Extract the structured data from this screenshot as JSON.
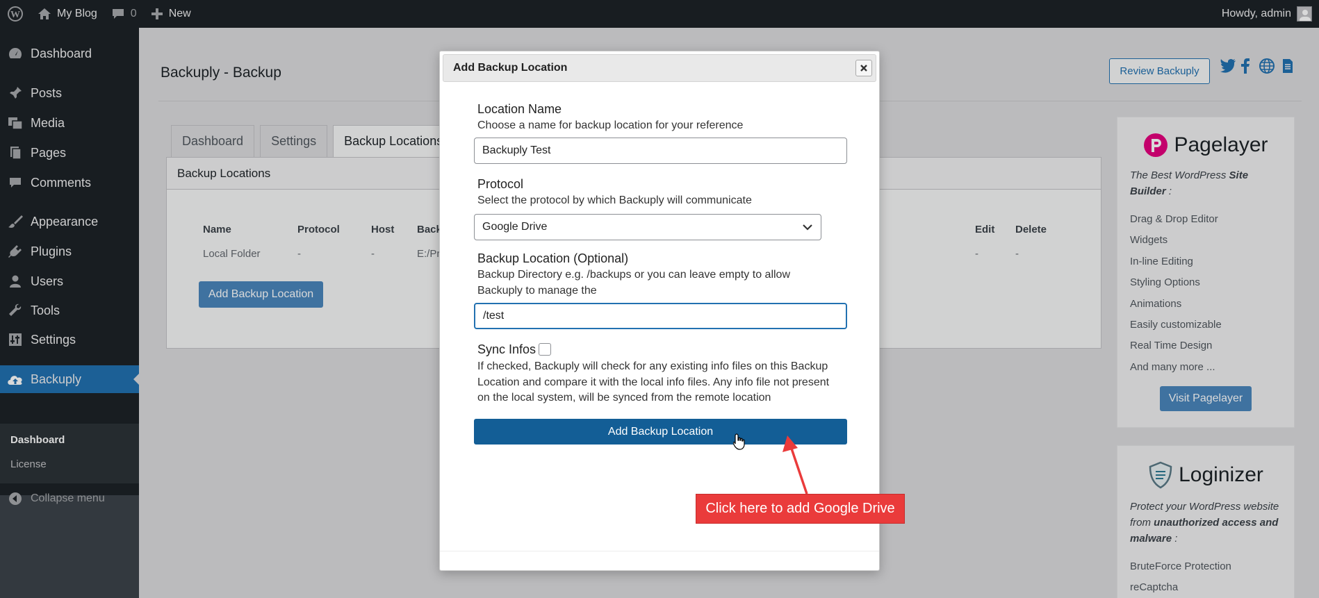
{
  "adminbar": {
    "site_name": "My Blog",
    "comments_count": "0",
    "new_label": "New",
    "greeting": "Howdy, admin"
  },
  "sidebar": {
    "items": [
      {
        "label": "Dashboard",
        "icon": "dashboard-icon"
      },
      {
        "label": "Posts",
        "icon": "pin-icon"
      },
      {
        "label": "Media",
        "icon": "media-icon"
      },
      {
        "label": "Pages",
        "icon": "pages-icon"
      },
      {
        "label": "Comments",
        "icon": "comment-icon"
      },
      {
        "label": "Appearance",
        "icon": "brush-icon"
      },
      {
        "label": "Plugins",
        "icon": "plugin-icon"
      },
      {
        "label": "Users",
        "icon": "user-icon"
      },
      {
        "label": "Tools",
        "icon": "wrench-icon"
      },
      {
        "label": "Settings",
        "icon": "settings-icon"
      },
      {
        "label": "Backuply",
        "icon": "cloud-upload-icon"
      }
    ],
    "submenu": [
      "Dashboard",
      "License"
    ],
    "collapse_label": "Collapse menu"
  },
  "main": {
    "title": "Backuply - Backup",
    "review_label": "Review Backuply",
    "tabs": [
      "Dashboard",
      "Settings",
      "Backup Locations"
    ],
    "panel_title": "Backup Locations",
    "table": {
      "headers": [
        "Name",
        "Protocol",
        "Host",
        "Back",
        "Edit",
        "Delete"
      ],
      "row": [
        "Local Folder",
        "-",
        "-",
        "E:/Pr",
        "-",
        "-"
      ]
    },
    "add_button": "Add Backup Location"
  },
  "pagelayer": {
    "brand": "Pagelayer",
    "tagline_1": "The Best WordPress ",
    "tagline_bold": "Site Builder",
    "tagline_2": " :",
    "features": [
      "Drag & Drop Editor",
      "Widgets",
      "In-line Editing",
      "Styling Options",
      "Animations",
      "Easily customizable",
      "Real Time Design",
      "And many more ..."
    ],
    "visit_label": "Visit Pagelayer"
  },
  "loginizer": {
    "brand": "Loginizer",
    "tagline_1": "Protect your WordPress website from ",
    "tagline_bold": "unauthorized access and malware",
    "tagline_2": " :",
    "features": [
      "BruteForce Protection",
      "reCaptcha"
    ]
  },
  "modal": {
    "title": "Add Backup Location",
    "location_name_label": "Location Name",
    "location_name_desc": "Choose a name for backup location for your reference",
    "location_name_value": "Backuply Test",
    "protocol_label": "Protocol",
    "protocol_desc": "Select the protocol by which Backuply will communicate",
    "protocol_value": "Google Drive",
    "backup_location_label": "Backup Location (Optional)",
    "backup_location_desc": "Backup Directory e.g. /backups or you can leave empty to allow Backuply to manage the",
    "backup_location_value": "/test",
    "sync_label": "Sync Infos",
    "sync_checked": false,
    "sync_desc": "If checked, Backuply will check for any existing info files on this Backup Location and compare it with the local info files. Any info file not present on the local system, will be synced from the remote location",
    "submit_label": "Add Backup Location"
  },
  "annotation": {
    "callout_text": "Click here to add Google Drive",
    "color": "#ea3b3b"
  },
  "colors": {
    "accent": "#2271b1",
    "submit": "#135e96",
    "adminbar": "#1d2327"
  }
}
